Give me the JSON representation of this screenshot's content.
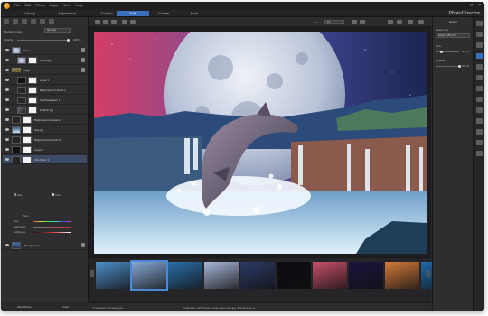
{
  "app": {
    "menu": [
      "File",
      "Edit",
      "Photo",
      "Layer",
      "View",
      "Help"
    ],
    "brand": "PhotoDirector",
    "window_controls": [
      "minimize-icon",
      "maximize-icon",
      "close-icon"
    ]
  },
  "modes": [
    {
      "label": "Library",
      "active": false
    },
    {
      "label": "Adjustment",
      "active": false
    },
    {
      "label": "Guided",
      "active": false
    },
    {
      "label": "Edit",
      "active": true
    },
    {
      "label": "Create",
      "active": false
    },
    {
      "label": "Print",
      "active": false
    }
  ],
  "layers_panel": {
    "blending_label": "Blending mode:",
    "blending_value": "Normal",
    "opacity_label": "Opacity:",
    "opacity_value": "100 %",
    "opacity_level": 1.0,
    "layers": [
      {
        "name": "Moon",
        "kind": "group",
        "indent": 0,
        "thumb": "moon",
        "mask": false
      },
      {
        "name": "Moon.jpg",
        "kind": "layer",
        "indent": 1,
        "thumb": "moon",
        "mask": true
      },
      {
        "name": "Layer",
        "kind": "group",
        "indent": 0,
        "thumb": "none",
        "mask": false
      },
      {
        "name": "Layer 1",
        "kind": "layer",
        "indent": 1,
        "thumb": "dark",
        "mask": true
      },
      {
        "name": "Brightness/Contrast 1",
        "kind": "adjust",
        "indent": 1,
        "thumb": "adjust",
        "mask": true
      },
      {
        "name": "Hue/Saturation 1",
        "kind": "adjust",
        "indent": 1,
        "thumb": "adjust",
        "mask": true
      },
      {
        "name": "Dolphin.jpg",
        "kind": "layer",
        "indent": 1,
        "thumb": "dolphin",
        "mask": true
      },
      {
        "name": "Brightness/Contrast 2",
        "kind": "adjust",
        "indent": 0,
        "thumb": "adjust",
        "mask": true
      },
      {
        "name": "Sea.jpg",
        "kind": "layer",
        "indent": 0,
        "thumb": "sea",
        "mask": true
      },
      {
        "name": "Brightness/Contrast 3",
        "kind": "adjust",
        "indent": 0,
        "thumb": "adjust",
        "mask": true
      },
      {
        "name": "Layer 2",
        "kind": "layer",
        "indent": 0,
        "thumb": "dark",
        "mask": true
      },
      {
        "name": "HSL/Color 1",
        "kind": "adjust",
        "indent": 0,
        "thumb": "adjust",
        "mask": true,
        "selected": true
      }
    ],
    "hsl": {
      "option_hsl": "HSL",
      "option_color": "Color",
      "color_label": "Pixel",
      "hue_label": "Hue",
      "saturation_label": "Saturation",
      "lightness_label": "Lightness"
    },
    "background_layer": "Background",
    "save_button": "Save/Share",
    "clear_button": "Clear"
  },
  "canvas_toolbar": {
    "zoom_label": "Zoom:",
    "zoom_value": "Fit"
  },
  "filmstrip": {
    "thumbs": [
      "#4d8fc8",
      "#86a9d6",
      "#2b6fa8",
      "#a8b6d8",
      "#2c3a66",
      "#0b0b12",
      "#c8506a",
      "#1a1440",
      "#d37b3a",
      "#1d6aa8"
    ],
    "selected_index": 1
  },
  "status": {
    "left": "1 selected / 16 displayed",
    "center": "Collection / All Photos / photo layer view.jpg (Virtual Copy 1)"
  },
  "right_panel": {
    "title": "Eraser",
    "select_tool_label": "Select tool:",
    "select_tool_value": "Eraser (Brush)",
    "size_label": "Size:",
    "size_value": "20 px",
    "size_level": 0.25,
    "opacity_label": "Opacity:",
    "opacity_value": "100 %",
    "opacity_level": 1.0
  },
  "colors": {
    "accent": "#3b6fbe",
    "panel": "#2e2e30",
    "sky_top": "#d23e62",
    "sky_right": "#1b2650"
  }
}
